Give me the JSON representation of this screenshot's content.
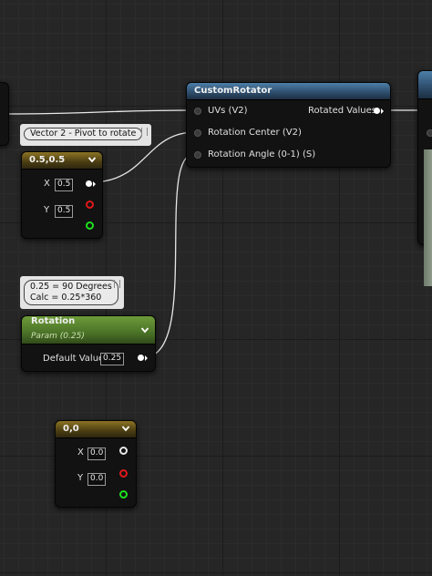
{
  "comments": {
    "pivot": "Vector 2 - Pivot to rotate",
    "rotation_line1": "0.25 = 90 Degrees",
    "rotation_line2": "Calc = 0.25*360"
  },
  "constant_pivot": {
    "title": "0.5,0.5",
    "x_label": "X",
    "x_value": "0.5",
    "y_label": "Y",
    "y_value": "0.5"
  },
  "custom_rotator": {
    "title": "CustomRotator",
    "input_uvs": "UVs (V2)",
    "input_center": "Rotation Center (V2)",
    "input_angle": "Rotation Angle (0-1) (S)",
    "output": "Rotated Values"
  },
  "rotation_param": {
    "title": "Rotation",
    "subtitle": "Param (0.25)",
    "default_label": "Default Value",
    "default_value": "0.25"
  },
  "constant_zero": {
    "title": "0,0",
    "x_label": "X",
    "x_value": "0.0",
    "y_label": "Y",
    "y_value": "0.0"
  },
  "colors": {
    "background": "#262626",
    "constant_header": "#8c7424",
    "function_header": "#4d7fa8",
    "param_header": "#6d9b3a",
    "wire": "#e8e8e8"
  }
}
